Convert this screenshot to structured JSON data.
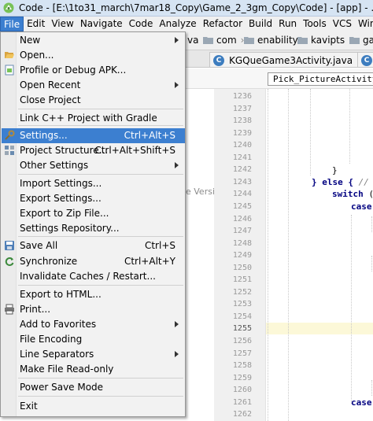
{
  "window": {
    "title": "Code - [E:\\1to31_march\\7mar18_Copy\\Game_2_3gm_Copy\\Code] - [app] - ...\\app\\src\\main\\"
  },
  "menubar": [
    "File",
    "Edit",
    "View",
    "Navigate",
    "Code",
    "Analyze",
    "Refactor",
    "Build",
    "Run",
    "Tools",
    "VCS",
    "Window"
  ],
  "navbar": {
    "crumbs": [
      "va",
      "com",
      "enability",
      "kavipts",
      "gam"
    ]
  },
  "tabs": [
    {
      "label": "KGQueGame3Activity.java"
    },
    {
      "label": "I"
    }
  ],
  "breadcrumb_pill": "Pick_PictureActivity",
  "left_panel_ghost_text": "e Versio",
  "file_menu": {
    "items": [
      {
        "label": "New",
        "shortcut": "",
        "submenu": true
      },
      {
        "label": "Open...",
        "shortcut": "",
        "icon": "folder-open-icon"
      },
      {
        "label": "Profile or Debug APK...",
        "shortcut": "",
        "icon": "apk-icon"
      },
      {
        "label": "Open Recent",
        "shortcut": "",
        "submenu": true
      },
      {
        "label": "Close Project",
        "shortcut": ""
      },
      {
        "separator": true
      },
      {
        "label": "Link C++ Project with Gradle",
        "shortcut": ""
      },
      {
        "separator": true
      },
      {
        "label": "Settings...",
        "shortcut": "Ctrl+Alt+S",
        "icon": "wrench-icon",
        "selected": true
      },
      {
        "label": "Project Structure...",
        "shortcut": "Ctrl+Alt+Shift+S",
        "icon": "project-structure-icon"
      },
      {
        "label": "Other Settings",
        "shortcut": "",
        "submenu": true
      },
      {
        "separator": true
      },
      {
        "label": "Import Settings...",
        "shortcut": ""
      },
      {
        "label": "Export Settings...",
        "shortcut": ""
      },
      {
        "label": "Export to Zip File...",
        "shortcut": ""
      },
      {
        "label": "Settings Repository...",
        "shortcut": ""
      },
      {
        "separator": true
      },
      {
        "label": "Save All",
        "shortcut": "Ctrl+S",
        "icon": "save-icon"
      },
      {
        "label": "Synchronize",
        "shortcut": "Ctrl+Alt+Y",
        "icon": "sync-icon"
      },
      {
        "label": "Invalidate Caches / Restart...",
        "shortcut": ""
      },
      {
        "separator": true
      },
      {
        "label": "Export to HTML...",
        "shortcut": ""
      },
      {
        "label": "Print...",
        "shortcut": "",
        "icon": "print-icon"
      },
      {
        "label": "Add to Favorites",
        "shortcut": "",
        "submenu": true
      },
      {
        "label": "File Encoding",
        "shortcut": ""
      },
      {
        "label": "Line Separators",
        "shortcut": "",
        "submenu": true
      },
      {
        "label": "Make File Read-only",
        "shortcut": ""
      },
      {
        "separator": true
      },
      {
        "label": "Power Save Mode",
        "shortcut": ""
      },
      {
        "separator": true
      },
      {
        "label": "Exit",
        "shortcut": ""
      }
    ]
  },
  "editor": {
    "line_numbers": [
      "1236",
      "1237",
      "1238",
      "1239",
      "1240",
      "1241",
      "1242",
      "1243",
      "1244",
      "1245",
      "1246",
      "1247",
      "1248",
      "1249",
      "1250",
      "1251",
      "1252",
      "1253",
      "1254",
      "1255",
      "1256",
      "1257",
      "1258",
      "1259",
      "1260",
      "1261",
      "1262"
    ],
    "highlighted_line": "1255",
    "code_lines": [
      {
        "line": "1242",
        "text": "}"
      },
      {
        "line": "1243",
        "kw": "} else {",
        "comment": "//"
      },
      {
        "line": "1244",
        "kw": "switch",
        "rest": " (n"
      },
      {
        "line": "1245",
        "kw": "case"
      },
      {
        "line": "1261",
        "kw": "case"
      }
    ]
  },
  "colors": {
    "selection": "#3c7fd0",
    "menu_bg": "#f2f2f2",
    "gutter_bg": "#f0f0f0",
    "current_line": "#fcf8d8"
  }
}
